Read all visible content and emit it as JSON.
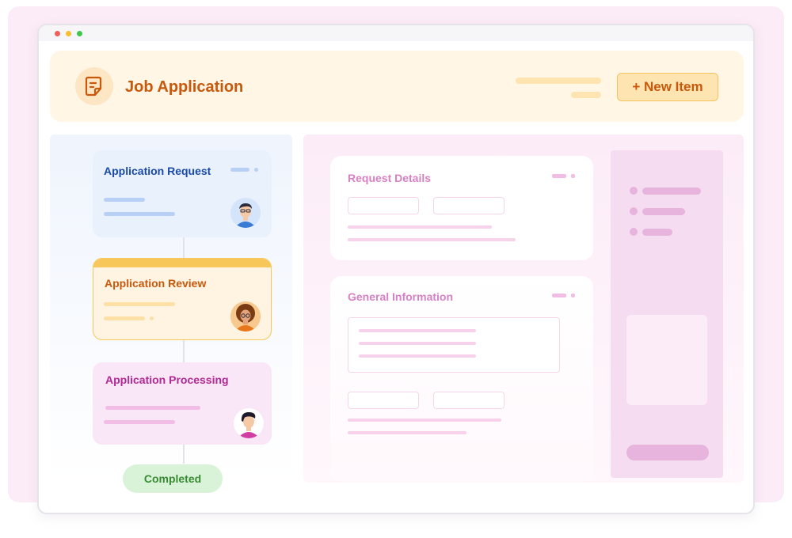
{
  "header": {
    "title": "Job Application",
    "new_item_label": "+ New Item",
    "icon": "document-icon"
  },
  "workflow": {
    "steps": [
      {
        "title": "Application Request",
        "color": "#1a4aa8",
        "background": "#e9f1fd",
        "avatar": "man-with-glasses-avatar"
      },
      {
        "title": "Application Review",
        "color": "#c8590c",
        "background": "#fff3e2",
        "accent": "#f8c75a",
        "avatar": "woman-with-curly-hair-avatar"
      },
      {
        "title": "Application Processing",
        "color": "#b02a94",
        "background": "#f9e6f6",
        "avatar": "man-with-dark-hair-avatar"
      }
    ],
    "completed_label": "Completed",
    "completed_color": "#3a8a35"
  },
  "form": {
    "request_details_title": "Request Details",
    "general_information_title": "General Information"
  },
  "colors": {
    "backdrop": "#fcecf7",
    "header_background": "#fff6e6",
    "accent_orange": "#c8590c",
    "accent_pink": "#d880c4"
  }
}
